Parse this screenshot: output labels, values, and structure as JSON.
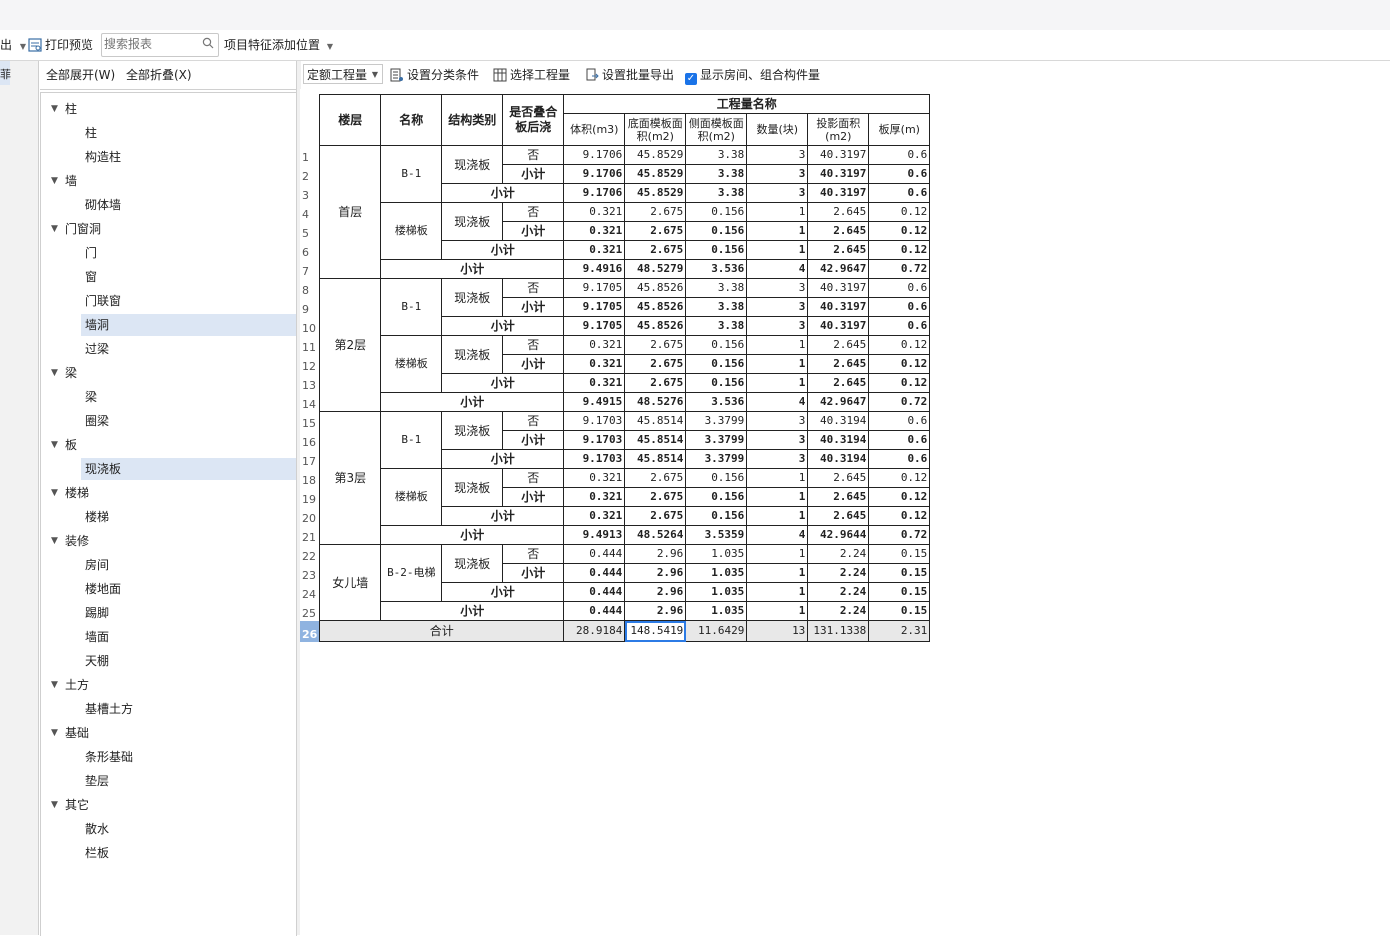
{
  "toolbar": {
    "export_fragment": "出",
    "print_preview": "打印预览",
    "search_placeholder": "搜索报表",
    "feature_position": "项目特征添加位置"
  },
  "leftstrip": {
    "label": "菲"
  },
  "tree": {
    "expand_all": "全部展开(W)",
    "collapse_all": "全部折叠(X)",
    "groups": [
      {
        "label": "柱",
        "items": [
          "柱",
          "构造柱"
        ]
      },
      {
        "label": "墙",
        "items": [
          "砌体墙"
        ]
      },
      {
        "label": "门窗洞",
        "items": [
          "门",
          "窗",
          "门联窗",
          "墙洞",
          "过梁"
        ]
      },
      {
        "label": "梁",
        "items": [
          "梁",
          "圈梁"
        ]
      },
      {
        "label": "板",
        "items": [
          "现浇板"
        ]
      },
      {
        "label": "楼梯",
        "items": [
          "楼梯"
        ]
      },
      {
        "label": "装修",
        "items": [
          "房间",
          "楼地面",
          "踢脚",
          "墙面",
          "天棚"
        ]
      },
      {
        "label": "土方",
        "items": [
          "基槽土方"
        ]
      },
      {
        "label": "基础",
        "items": [
          "条形基础",
          "垫层"
        ]
      },
      {
        "label": "其它",
        "items": [
          "散水",
          "栏板"
        ]
      }
    ],
    "selected": [
      "墙洞",
      "现浇板"
    ]
  },
  "right_toolbar": {
    "quantity_type": "定额工程量",
    "set_category": "设置分类条件",
    "select_quantity": "选择工程量",
    "batch_export": "设置批量导出",
    "show_rooms": "显示房间、组合构件量",
    "show_rooms_checked": true
  },
  "table": {
    "headers": {
      "floor": "楼层",
      "name": "名称",
      "struct_type": "结构类别",
      "overlap": "是否叠合板后浇",
      "quantity_group": "工程量名称",
      "volume": "体积(m3)",
      "bottom_form": "底面模板面积(m2)",
      "side_form": "侧面模板面积(m2)",
      "count": "数量(块)",
      "proj_area": "投影面积(m2)",
      "thickness": "板厚(m)"
    },
    "floors": [
      {
        "name": "首层",
        "components": [
          {
            "name": "B-1",
            "type": "现浇板",
            "overlap": "否",
            "detail": [
              "9.1706",
              "45.8529",
              "3.38",
              "3",
              "40.3197",
              "0.6"
            ],
            "sub1": [
              "9.1706",
              "45.8529",
              "3.38",
              "3",
              "40.3197",
              "0.6"
            ],
            "sub2": [
              "9.1706",
              "45.8529",
              "3.38",
              "3",
              "40.3197",
              "0.6"
            ]
          },
          {
            "name": "楼梯板",
            "type": "现浇板",
            "overlap": "否",
            "detail": [
              "0.321",
              "2.675",
              "0.156",
              "1",
              "2.645",
              "0.12"
            ],
            "sub1": [
              "0.321",
              "2.675",
              "0.156",
              "1",
              "2.645",
              "0.12"
            ],
            "sub2": [
              "0.321",
              "2.675",
              "0.156",
              "1",
              "2.645",
              "0.12"
            ]
          }
        ],
        "total": [
          "9.4916",
          "48.5279",
          "3.536",
          "4",
          "42.9647",
          "0.72"
        ]
      },
      {
        "name": "第2层",
        "components": [
          {
            "name": "B-1",
            "type": "现浇板",
            "overlap": "否",
            "detail": [
              "9.1705",
              "45.8526",
              "3.38",
              "3",
              "40.3197",
              "0.6"
            ],
            "sub1": [
              "9.1705",
              "45.8526",
              "3.38",
              "3",
              "40.3197",
              "0.6"
            ],
            "sub2": [
              "9.1705",
              "45.8526",
              "3.38",
              "3",
              "40.3197",
              "0.6"
            ]
          },
          {
            "name": "楼梯板",
            "type": "现浇板",
            "overlap": "否",
            "detail": [
              "0.321",
              "2.675",
              "0.156",
              "1",
              "2.645",
              "0.12"
            ],
            "sub1": [
              "0.321",
              "2.675",
              "0.156",
              "1",
              "2.645",
              "0.12"
            ],
            "sub2": [
              "0.321",
              "2.675",
              "0.156",
              "1",
              "2.645",
              "0.12"
            ]
          }
        ],
        "total": [
          "9.4915",
          "48.5276",
          "3.536",
          "4",
          "42.9647",
          "0.72"
        ]
      },
      {
        "name": "第3层",
        "components": [
          {
            "name": "B-1",
            "type": "现浇板",
            "overlap": "否",
            "detail": [
              "9.1703",
              "45.8514",
              "3.3799",
              "3",
              "40.3194",
              "0.6"
            ],
            "sub1": [
              "9.1703",
              "45.8514",
              "3.3799",
              "3",
              "40.3194",
              "0.6"
            ],
            "sub2": [
              "9.1703",
              "45.8514",
              "3.3799",
              "3",
              "40.3194",
              "0.6"
            ]
          },
          {
            "name": "楼梯板",
            "type": "现浇板",
            "overlap": "否",
            "detail": [
              "0.321",
              "2.675",
              "0.156",
              "1",
              "2.645",
              "0.12"
            ],
            "sub1": [
              "0.321",
              "2.675",
              "0.156",
              "1",
              "2.645",
              "0.12"
            ],
            "sub2": [
              "0.321",
              "2.675",
              "0.156",
              "1",
              "2.645",
              "0.12"
            ]
          }
        ],
        "total": [
          "9.4913",
          "48.5264",
          "3.5359",
          "4",
          "42.9644",
          "0.72"
        ]
      },
      {
        "name": "女儿墙",
        "components": [
          {
            "name": "B-2-电梯",
            "type": "现浇板",
            "overlap": "否",
            "detail": [
              "0.444",
              "2.96",
              "1.035",
              "1",
              "2.24",
              "0.15"
            ],
            "sub1": [
              "0.444",
              "2.96",
              "1.035",
              "1",
              "2.24",
              "0.15"
            ],
            "sub2": [
              "0.444",
              "2.96",
              "1.035",
              "1",
              "2.24",
              "0.15"
            ]
          }
        ],
        "total": [
          "0.444",
          "2.96",
          "1.035",
          "1",
          "2.24",
          "0.15"
        ]
      }
    ],
    "subtotal_label": "小计",
    "grand_total_label": "合计",
    "grand_total": [
      "28.9184",
      "148.5419",
      "11.6429",
      "13",
      "131.1338",
      "2.31"
    ],
    "row_numbers": [
      "1",
      "2",
      "3",
      "4",
      "5",
      "6",
      "7",
      "8",
      "9",
      "10",
      "11",
      "12",
      "13",
      "14",
      "15",
      "16",
      "17",
      "18",
      "19",
      "20",
      "21",
      "22",
      "23",
      "24",
      "25",
      "26"
    ]
  }
}
